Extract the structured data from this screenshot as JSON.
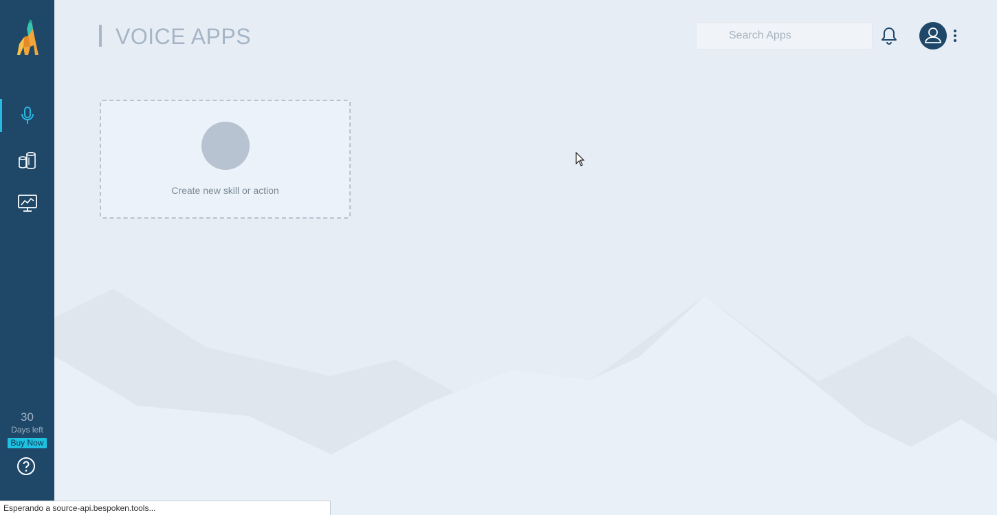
{
  "sidebar": {
    "logo_icon": "llama-logo",
    "nav_items": [
      {
        "icon": "microphone-icon",
        "active": true
      },
      {
        "icon": "devices-icon",
        "active": false
      },
      {
        "icon": "monitor-chart-icon",
        "active": false
      }
    ],
    "trial": {
      "days": "30",
      "label": "Days left",
      "buy_label": "Buy Now"
    },
    "help_icon": "help-circle-icon"
  },
  "header": {
    "title": "VOICE APPS",
    "search": {
      "placeholder": "Search Apps",
      "value": ""
    },
    "notification_icon": "bell-icon",
    "avatar_icon": "user-icon",
    "menu_icon": "kebab-menu-icon"
  },
  "main": {
    "create_card": {
      "label": "Create new skill or action"
    }
  },
  "status_bar": {
    "text": "Esperando a source-api.bespoken.tools..."
  },
  "colors": {
    "sidebar": "#1e4768",
    "accent": "#29b8e0",
    "buy_now": "#1ec2e0",
    "background": "#e6edf5"
  }
}
